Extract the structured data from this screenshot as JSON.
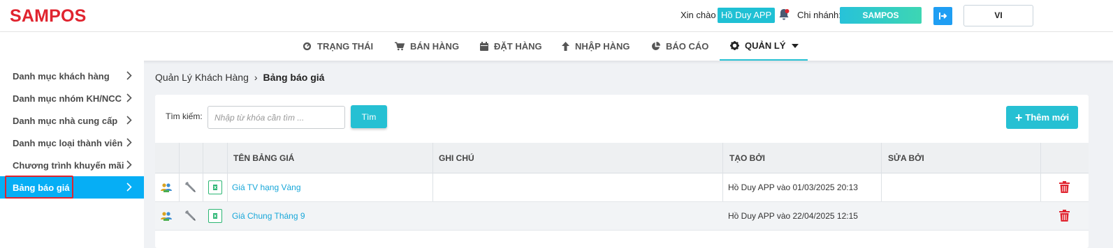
{
  "header": {
    "logo": "SAMPOS",
    "greeting": "Xin chào",
    "user_name": "Hồ Duy APP",
    "branch_label": "Chi nhánh:",
    "branch_name": "SAMPOS",
    "language": "VI"
  },
  "nav": {
    "items": [
      {
        "label": "TRẠNG THÁI",
        "icon": "dashboard-icon"
      },
      {
        "label": "BÁN HÀNG",
        "icon": "cart-icon"
      },
      {
        "label": "ĐẶT HÀNG",
        "icon": "calendar-icon"
      },
      {
        "label": "NHẬP HÀNG",
        "icon": "arrow-up-icon"
      },
      {
        "label": "BÁO CÁO",
        "icon": "pie-chart-icon"
      },
      {
        "label": "QUẢN LÝ",
        "icon": "gear-icon",
        "active": true
      }
    ]
  },
  "sidebar": {
    "items": [
      {
        "label": "Danh mục khách hàng"
      },
      {
        "label": "Danh mục nhóm KH/NCC"
      },
      {
        "label": "Danh mục nhà cung cấp"
      },
      {
        "label": "Danh mục loại thành viên"
      },
      {
        "label": "Chương trình khuyến mãi"
      },
      {
        "label": "Bảng báo giá",
        "active": true
      }
    ]
  },
  "breadcrumb": {
    "parent": "Quản Lý Khách Hàng",
    "separator": "›",
    "current": "Bảng báo giá"
  },
  "search": {
    "label": "Tìm kiếm:",
    "placeholder": "Nhập từ khóa cần tìm ...",
    "value": "",
    "button": "Tìm"
  },
  "add_button": "Thêm mới",
  "table": {
    "columns": [
      "TÊN BẢNG GIÁ",
      "GHI CHÚ",
      "TẠO BỞI",
      "SỬA BỞI"
    ],
    "rows": [
      {
        "name": "Giá TV hạng Vàng",
        "note": "",
        "created_by": "Hồ Duy APP vào 01/03/2025 20:13",
        "edited_by": ""
      },
      {
        "name": "Giá Chung Tháng 9",
        "note": "",
        "created_by": "Hồ Duy APP vào 22/04/2025 12:15",
        "edited_by": ""
      }
    ]
  },
  "colors": {
    "brand": "#e0242f",
    "accent": "#26c0d3",
    "sidebar_active": "#06aef5",
    "link": "#18a7d9",
    "delete": "#e0242f"
  }
}
